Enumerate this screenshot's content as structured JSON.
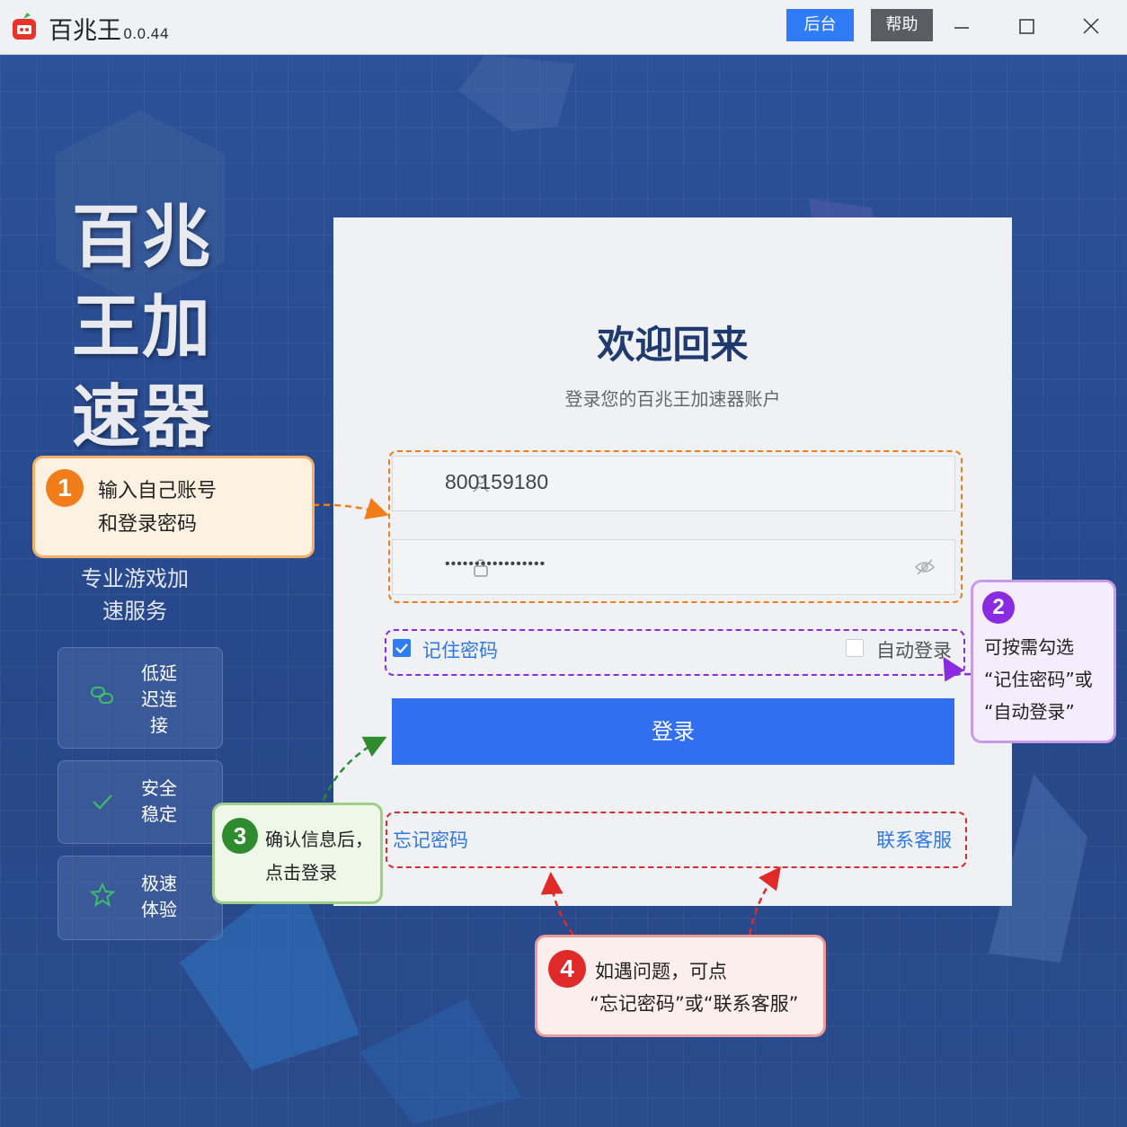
{
  "app": {
    "name": "百兆王",
    "version": "0.0.44"
  },
  "titlebar": {
    "backend_label": "后台",
    "help_label": "帮助"
  },
  "hero": {
    "title_lines": [
      "百兆",
      "王加",
      "速器"
    ],
    "subtitle_lines": [
      "专业游戏加",
      "速服务"
    ]
  },
  "features": [
    {
      "icon": "link-icon",
      "lines": [
        "低延",
        "迟连",
        "接"
      ]
    },
    {
      "icon": "check-icon",
      "lines": [
        "安全",
        "稳定"
      ]
    },
    {
      "icon": "star-icon",
      "lines": [
        "极速",
        "体验"
      ]
    }
  ],
  "login": {
    "welcome": "欢迎回来",
    "subtitle": "登录您的百兆王加速器账户",
    "account_value": "800159180",
    "password_masked": "•••••••••••••••••",
    "remember_label": "记住密码",
    "remember_checked": true,
    "auto_login_label": "自动登录",
    "auto_login_checked": false,
    "submit_label": "登录",
    "forgot_label": "忘记密码",
    "contact_label": "联系客服"
  },
  "callouts": [
    {
      "number": "1",
      "lines": [
        "输入自己账号",
        "和登录密码"
      ]
    },
    {
      "number": "2",
      "lines": [
        "可按需勾选",
        "“记住密码”或",
        "“自动登录”"
      ]
    },
    {
      "number": "3",
      "lines": [
        "确认信息后，",
        "点击登录"
      ]
    },
    {
      "number": "4",
      "lines": [
        "如遇问题，可点",
        "“忘记密码”或“联系客服”"
      ]
    }
  ],
  "colors": {
    "accent_blue": "#2f6ff0",
    "callout1": "#f07d1a",
    "callout2": "#8a2be2",
    "callout3": "#2e8b2e",
    "callout4": "#e02a2a"
  }
}
